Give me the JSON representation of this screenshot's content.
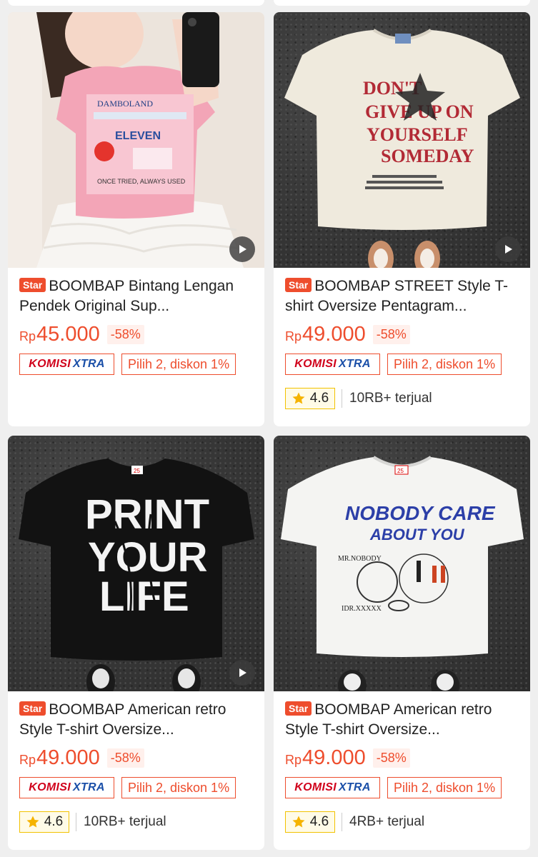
{
  "products": [
    {
      "badge": "Star",
      "title": "BOOMBAP Bintang Lengan Pendek Original Sup...",
      "currency": "Rp",
      "price": "45.000",
      "discount": "-58%",
      "komisi_a": "KOMISI",
      "komisi_b": "XTRA",
      "promo": "Pilih 2, diskon 1%",
      "has_video": true
    },
    {
      "badge": "Star",
      "title": "BOOMBAP STREET Style T-shirt Oversize Pentagram...",
      "currency": "Rp",
      "price": "49.000",
      "discount": "-58%",
      "komisi_a": "KOMISI",
      "komisi_b": "XTRA",
      "promo": "Pilih 2, diskon 1%",
      "rating": "4.6",
      "sold": "10RB+ terjual",
      "has_video": true
    },
    {
      "badge": "Star",
      "title": "BOOMBAP American retro Style T-shirt Oversize...",
      "currency": "Rp",
      "price": "49.000",
      "discount": "-58%",
      "komisi_a": "KOMISI",
      "komisi_b": "XTRA",
      "promo": "Pilih 2, diskon 1%",
      "rating": "4.6",
      "sold": "10RB+ terjual",
      "has_video": true
    },
    {
      "badge": "Star",
      "title": "BOOMBAP American retro Style T-shirt Oversize...",
      "currency": "Rp",
      "price": "49.000",
      "discount": "-58%",
      "komisi_a": "KOMISI",
      "komisi_b": "XTRA",
      "promo": "Pilih 2, diskon 1%",
      "rating": "4.6",
      "sold": "4RB+ terjual",
      "has_video": false
    }
  ],
  "shirt_prints": {
    "p2_lines": [
      "DON'T",
      "GIVE UP ON",
      "YOURSELF",
      "SOMEDAY"
    ],
    "p3_lines": [
      "PRINT",
      "YOUR",
      "LIFE"
    ],
    "p4_lines": [
      "NOBODY CARE",
      "ABOUT YOU"
    ],
    "p4_sub": [
      "MR.NOBODY",
      "IDR.XXXXX"
    ],
    "size_tag": "25"
  },
  "colors": {
    "accent": "#ee4d2d",
    "komisi_blue": "#1a4fa8",
    "rating_border": "#f2c200"
  }
}
